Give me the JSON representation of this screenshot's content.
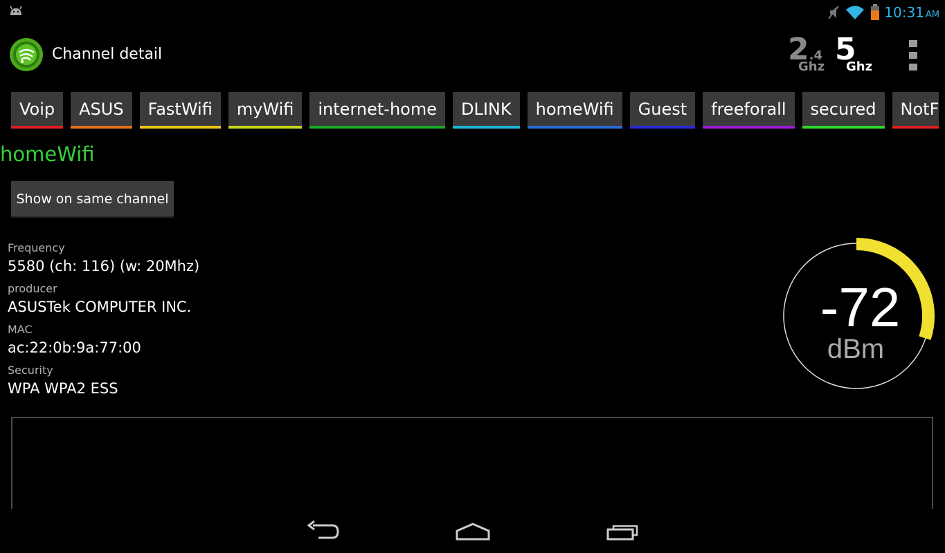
{
  "status_bar": {
    "time": "10:31",
    "ampm": "AM",
    "icons": [
      "android-icon",
      "mute-icon",
      "wifi-icon",
      "battery-icon"
    ]
  },
  "action_bar": {
    "title": "Channel detail",
    "band_24": {
      "big": "2",
      "small": ".4",
      "unit": "Ghz"
    },
    "band_5": {
      "big": "5",
      "unit": "Ghz"
    }
  },
  "tabs": [
    {
      "label": "Voip",
      "color": "#e02020"
    },
    {
      "label": "ASUS",
      "color": "#e8701a"
    },
    {
      "label": "FastWifi",
      "color": "#e8c61a"
    },
    {
      "label": "myWifi",
      "color": "#c8d81a"
    },
    {
      "label": "internet-home",
      "color": "#1aa82a"
    },
    {
      "label": "DLINK",
      "color": "#19b6d8"
    },
    {
      "label": "homeWifi",
      "color": "#2a6cd8"
    },
    {
      "label": "Guest",
      "color": "#2a2ad8"
    },
    {
      "label": "freeforall",
      "color": "#9a1ad8"
    },
    {
      "label": "secured",
      "color": "#2ad82a"
    },
    {
      "label": "NotForYou",
      "color": "#e02020"
    }
  ],
  "network": {
    "name": "homeWifi",
    "name_color": "#33d03a",
    "show_button": "Show on same channel"
  },
  "details": [
    {
      "label": "Frequency",
      "value": "5580 (ch: 116) (w: 20Mhz)"
    },
    {
      "label": "producer",
      "value": "ASUSTek COMPUTER INC."
    },
    {
      "label": "MAC",
      "value": "ac:22:0b:9a:77:00"
    },
    {
      "label": "Security",
      "value": "WPA WPA2 ESS"
    }
  ],
  "signal": {
    "value": "-72",
    "unit": "dBm",
    "arc_fraction": 0.3,
    "arc_color": "#f0e030"
  }
}
